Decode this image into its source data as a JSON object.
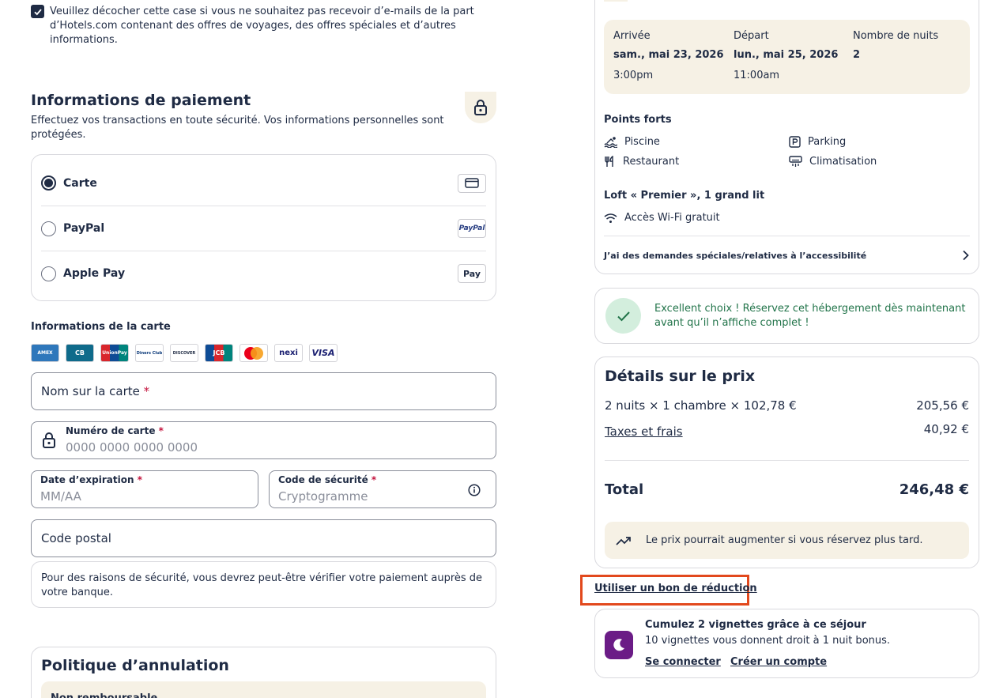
{
  "newsletter": {
    "text": "Veuillez décocher cette case si vous ne souhaitez pas recevoir d’e-mails de la part d’Hotels.com contenant des offres de voyages, des offres spéciales et d’autres informations.",
    "checked": true
  },
  "payment": {
    "title": "Informations de paiement",
    "subtitle": "Effectuez vos transactions en toute sécurité. Vos informations personnelles sont protégées.",
    "methods": [
      {
        "label": "Carte",
        "selected": true,
        "logo": "card-icon"
      },
      {
        "label": "PayPal",
        "selected": false,
        "logo": "PayPal"
      },
      {
        "label": "Apple Pay",
        "selected": false,
        "logo": "Pay"
      }
    ]
  },
  "card_info": {
    "title": "Informations de la carte",
    "brands": [
      "AMEX",
      "CB",
      "UnionPay",
      "Diners Club",
      "DISCOVER",
      "JCB",
      "Mastercard",
      "nexi",
      "VISA"
    ],
    "name_field": {
      "placeholder": "Nom sur la carte",
      "required": "*"
    },
    "number_field": {
      "label": "Numéro de carte",
      "required": "*",
      "placeholder": "0000 0000 0000 0000"
    },
    "expiry_field": {
      "label": "Date d’expiration",
      "required": "*",
      "placeholder": "MM/AA"
    },
    "cvv_field": {
      "label": "Code de sécurité",
      "required": "*",
      "placeholder": "Cryptogramme"
    },
    "postal_field": {
      "placeholder": "Code postal"
    },
    "security_notice": "Pour des raisons de sécurité, vous devrez peut-être vérifier votre paiement auprès de votre banque."
  },
  "cancellation": {
    "title": "Politique d’annulation",
    "item": "Non remboursable"
  },
  "stay": {
    "arrival_label": "Arrivée",
    "arrival_date": "sam., mai 23, 2026",
    "arrival_time": "3:00pm",
    "departure_label": "Départ",
    "departure_date": "lun., mai 25, 2026",
    "departure_time": "11:00am",
    "nights_label": "Nombre de nuits",
    "nights_value": "2",
    "highlights_title": "Points forts",
    "highlights": [
      "Piscine",
      "Parking",
      "Restaurant",
      "Climatisation"
    ],
    "room_title": "Loft « Premier », 1 grand lit",
    "room_amenity": "Accès Wi-Fi gratuit",
    "special_requests": "J’ai des demandes spéciales/relatives à l’accessibilité"
  },
  "choice_message": "Excellent choix ! Réservez cet hébergement dès maintenant avant qu’il n’affiche complet !",
  "price": {
    "title": "Détails sur le prix",
    "line_label": "2 nuits × 1 chambre × 102,78 €",
    "line_value": "205,56 €",
    "taxes_label": "Taxes et frais",
    "taxes_value": "40,92 €",
    "total_label": "Total",
    "total_value": "246,48 €",
    "trend_note": "Le prix pourrait augmenter si vous réservez plus tard."
  },
  "coupon_link": "Utiliser un bon de réduction",
  "loyalty": {
    "title": "Cumulez 2 vignettes grâce à ce séjour",
    "subtitle": "10 vignettes vous donnent droit à 1 nuit bonus.",
    "login": "Se connecter",
    "signup": "Créer un compte"
  },
  "colors": {
    "text": "#1f2b44",
    "beige": "#f6f1e5",
    "success_green": "#22744a",
    "success_bg": "#d3eedd",
    "required_red": "#c4133d",
    "highlight_orange": "#e2491d",
    "loyalty_purple": "#6b1c86"
  }
}
